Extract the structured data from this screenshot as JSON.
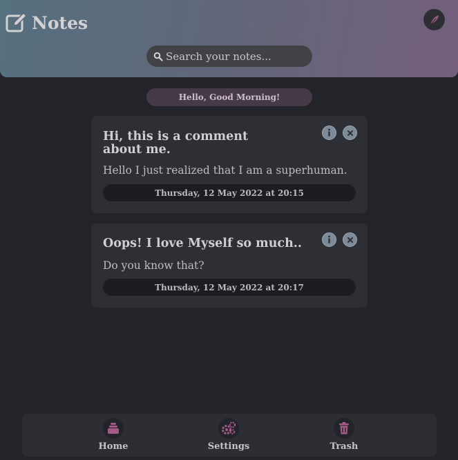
{
  "header": {
    "title": "Notes",
    "search_placeholder": "Search your notes..."
  },
  "greeting": "Hello, Good Morning!",
  "notes": [
    {
      "title": "Hi, this is a comment about me.",
      "body": "Hello I just realized that I am a superhuman.",
      "date": "Thursday, 12 May 2022 at 20:15"
    },
    {
      "title": "Oops! I love Myself so much..",
      "body": "Do you know that?",
      "date": "Thursday, 12 May 2022 at 20:17"
    }
  ],
  "nav": {
    "home": "Home",
    "settings": "Settings",
    "trash": "Trash"
  },
  "icons": {
    "brand": "edit-note-icon",
    "profile": "feather-icon",
    "search": "search-icon",
    "info": "info-icon",
    "close": "close-icon",
    "home": "inbox-stack-icon",
    "settings": "gears-icon",
    "trash": "trash-icon"
  },
  "colors": {
    "accent": "#a35a86",
    "background": "#232429",
    "card": "#2e2f34"
  }
}
